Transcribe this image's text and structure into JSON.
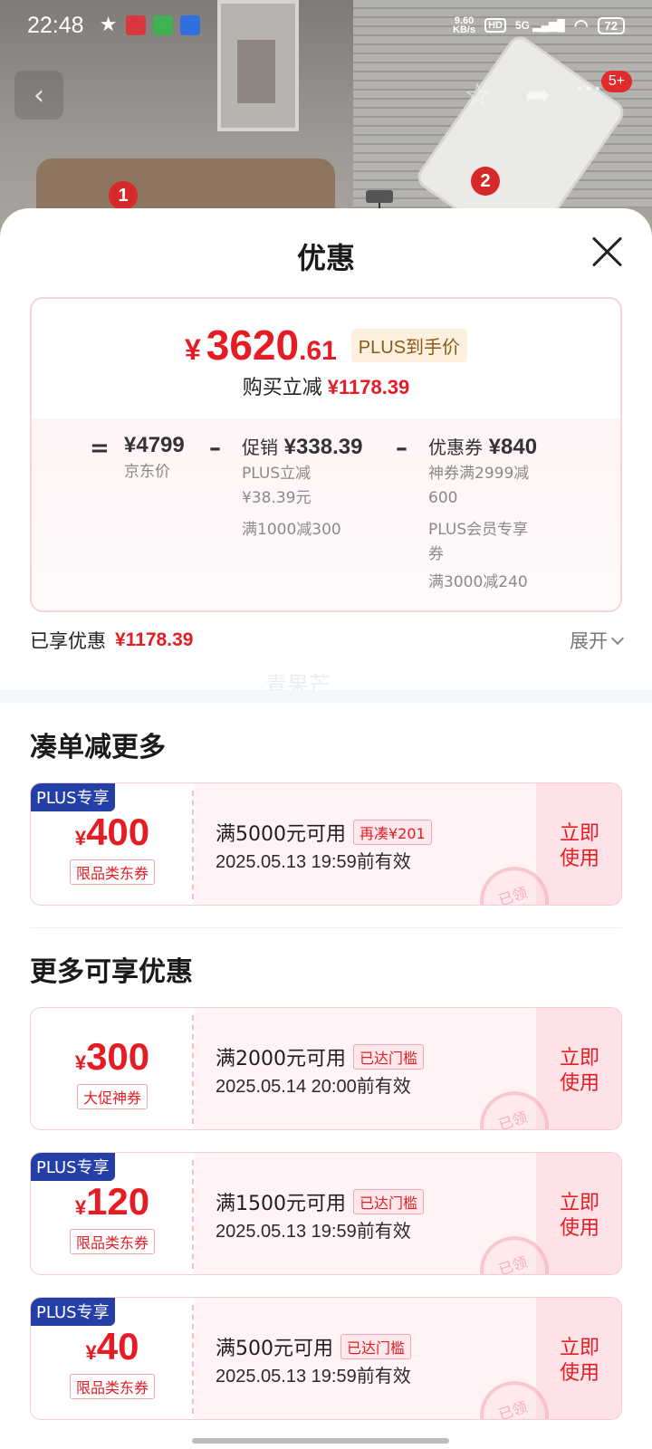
{
  "status": {
    "time": "22:48",
    "net_speed": "9.60\nKB/s",
    "hd": "HD",
    "signal": "5G",
    "battery": "72"
  },
  "nav": {
    "back_icon": "chevron-left-icon",
    "cart_badge": "5+"
  },
  "photo": {
    "marker1": "1",
    "marker2": "2"
  },
  "sheet": {
    "title": "优惠",
    "final_price": {
      "yen": "¥",
      "int": "3620",
      "dec": ".61",
      "tag": "PLUS到手价"
    },
    "discount_line": {
      "label": "购买立减",
      "amount": "¥1178.39"
    },
    "breakdown": {
      "eq": "=",
      "minus": "–",
      "base": {
        "amount": "¥4799",
        "label": "京东价"
      },
      "promo": {
        "label": "促销",
        "amount": "¥338.39",
        "lines": [
          "PLUS立减",
          "¥38.39元",
          "满1000减300"
        ]
      },
      "coupon": {
        "label": "优惠券",
        "amount": "¥840",
        "lines": [
          "神券满2999减",
          "600",
          "PLUS会员专享",
          "券",
          "满3000减240"
        ]
      }
    },
    "saved": {
      "label": "已享优惠",
      "amount": "¥1178.39",
      "expand": "展开"
    },
    "watermark": "青果芒",
    "section1": "凑单减更多",
    "section2": "更多可享优惠",
    "coupons": [
      {
        "plus": "PLUS专享",
        "yen": "¥",
        "amount": "400",
        "type": "限品类东券",
        "condition": "满5000元可用",
        "tag": "再凑¥201",
        "validity": "2025.05.13 19:59前有效",
        "action": "立即使用",
        "stamp": "已领"
      },
      {
        "plus": "",
        "yen": "¥",
        "amount": "300",
        "type": "大促神券",
        "condition": "满2000元可用",
        "tag": "已达门槛",
        "validity": "2025.05.14 20:00前有效",
        "action": "立即使用",
        "stamp": "已领"
      },
      {
        "plus": "PLUS专享",
        "yen": "¥",
        "amount": "120",
        "type": "限品类东券",
        "condition": "满1500元可用",
        "tag": "已达门槛",
        "validity": "2025.05.13 19:59前有效",
        "action": "立即使用",
        "stamp": "已领"
      },
      {
        "plus": "PLUS专享",
        "yen": "¥",
        "amount": "40",
        "type": "限品类东券",
        "condition": "满500元可用",
        "tag": "已达门槛",
        "validity": "2025.05.13 19:59前有效",
        "action": "立即使用",
        "stamp": "已领"
      }
    ]
  }
}
